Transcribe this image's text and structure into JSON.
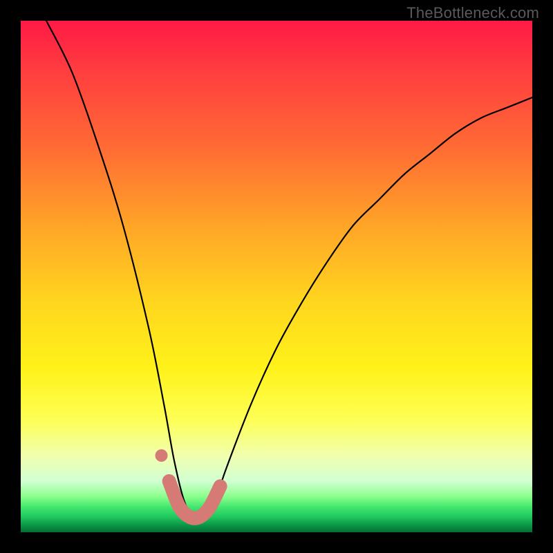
{
  "watermark": "TheBottleneck.com",
  "chart_data": {
    "type": "line",
    "title": "",
    "xlabel": "",
    "ylabel": "",
    "grid": false,
    "axes_visible": false,
    "background": "vertical red-to-green gradient",
    "frame_color": "#000",
    "x_range": [
      0,
      100
    ],
    "y_range": [
      0,
      100
    ],
    "series": [
      {
        "name": "bottleneck-curve",
        "description": "V-shaped curve descending steeply from top-left, reaching minimum near x≈33, then rising with decreasing slope toward top-right",
        "x": [
          5,
          10,
          15,
          20,
          25,
          28,
          30,
          32,
          34,
          36,
          38,
          40,
          45,
          50,
          55,
          60,
          65,
          70,
          75,
          80,
          85,
          90,
          95,
          100
        ],
        "y": [
          100,
          90,
          76,
          60,
          40,
          25,
          14,
          6,
          3,
          3,
          6,
          12,
          25,
          36,
          45,
          53,
          60,
          65,
          70,
          74,
          78,
          81,
          83,
          85
        ]
      }
    ],
    "marker": {
      "description": "thick salmon segment hugging the trough of the curve plus one detached dot to its upper-left",
      "color": "#d67a75",
      "segment_x": [
        29,
        31,
        33,
        35,
        37,
        39
      ],
      "segment_y": [
        10,
        5,
        3,
        3,
        5,
        9
      ],
      "dot": {
        "x": 27.5,
        "y": 15
      }
    },
    "background_gradient_stops": [
      {
        "pos": 0.0,
        "color": "#ff1a46"
      },
      {
        "pos": 0.4,
        "color": "#ffa427"
      },
      {
        "pos": 0.68,
        "color": "#fff21a"
      },
      {
        "pos": 0.9,
        "color": "#d2ffd2"
      },
      {
        "pos": 1.0,
        "color": "#066e34"
      }
    ]
  }
}
